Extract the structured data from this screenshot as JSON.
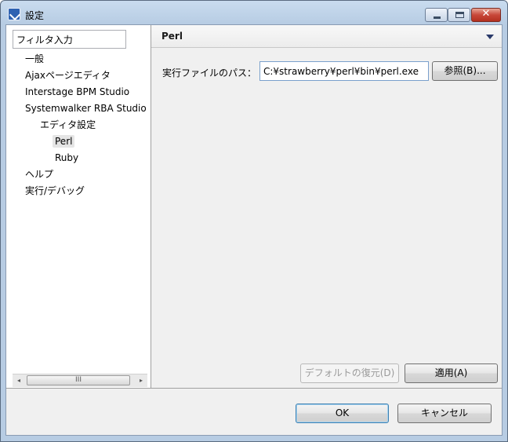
{
  "window": {
    "title": "設定"
  },
  "filter": {
    "value": "フィルタ入力"
  },
  "tree": {
    "items": [
      {
        "label": "一般",
        "level": 0
      },
      {
        "label": "Ajaxページエディタ",
        "level": 0
      },
      {
        "label": "Interstage BPM Studio",
        "level": 0
      },
      {
        "label": "Systemwalker RBA Studio",
        "level": 0
      },
      {
        "label": "エディタ設定",
        "level": 1
      },
      {
        "label": "Perl",
        "level": 2,
        "selected": true
      },
      {
        "label": "Ruby",
        "level": 2
      },
      {
        "label": "ヘルプ",
        "level": 0
      },
      {
        "label": "実行/デバッグ",
        "level": 0
      }
    ]
  },
  "scrollbar": {
    "left_arrow": "◂",
    "right_arrow": "▸",
    "thumb_grip": "III"
  },
  "page": {
    "title": "Perl",
    "path_label": "実行ファイルのパス：",
    "path_value": "C:¥strawberry¥perl¥bin¥perl.exe",
    "browse_label": "参照(B)...",
    "restore_defaults_label": "デフォルトの復元(D)",
    "apply_label": "適用(A)"
  },
  "dialog": {
    "ok_label": "OK",
    "cancel_label": "キャンセル"
  },
  "colors": {
    "title_bar": "#b7cce3",
    "close_button": "#c8473a",
    "default_button_border": "#3c7fb1"
  },
  "icons": [
    "app-icon",
    "minimize-icon",
    "maximize-icon",
    "close-icon",
    "menu-dropdown-icon",
    "scroll-left-icon",
    "scroll-right-icon"
  ]
}
